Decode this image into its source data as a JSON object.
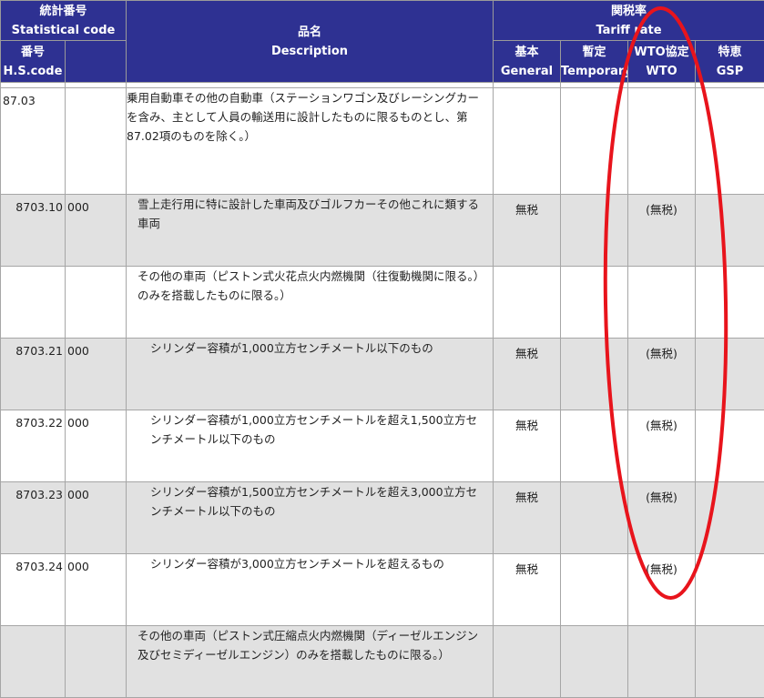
{
  "header": {
    "stat_code_jp": "統計番号",
    "stat_code_en": "Statistical code",
    "hs_jp": "番号",
    "hs_en": "H.S.code",
    "desc_jp": "品名",
    "desc_en": "Description",
    "tariff_jp": "関税率",
    "tariff_en": "Tariff rate",
    "general_jp": "基本",
    "general_en": "General",
    "temporary_jp": "暫定",
    "temporary_en": "Temporary",
    "wto_jp": "WTO協定",
    "wto_en": "WTO",
    "gsp_jp": "特恵",
    "gsp_en": "GSP"
  },
  "rows": [
    {
      "hs": "87.03",
      "stat": "",
      "desc": "乗用自動車その他の自動車（ステーションワゴン及びレーシングカーを含み、主として人員の輸送用に設計したものに限るものとし、第87.02項のものを除く。）",
      "general": "",
      "temporary": "",
      "wto": "",
      "gsp": ""
    },
    {
      "hs": "8703.10",
      "stat": "000",
      "desc": "雪上走行用に特に設計した車両及びゴルフカーその他これに類する車両",
      "general": "無税",
      "temporary": "",
      "wto": "(無税)",
      "gsp": ""
    },
    {
      "hs": "",
      "stat": "",
      "desc": "その他の車両（ピストン式火花点火内燃機関（往復動機関に限る。）のみを搭載したものに限る。）",
      "general": "",
      "temporary": "",
      "wto": "",
      "gsp": ""
    },
    {
      "hs": "8703.21",
      "stat": "000",
      "desc": "シリンダー容積が1,000立方センチメートル以下のもの",
      "general": "無税",
      "temporary": "",
      "wto": "(無税)",
      "gsp": ""
    },
    {
      "hs": "8703.22",
      "stat": "000",
      "desc": "シリンダー容積が1,000立方センチメートルを超え1,500立方センチメートル以下のもの",
      "general": "無税",
      "temporary": "",
      "wto": "(無税)",
      "gsp": ""
    },
    {
      "hs": "8703.23",
      "stat": "000",
      "desc": "シリンダー容積が1,500立方センチメートルを超え3,000立方センチメートル以下のもの",
      "general": "無税",
      "temporary": "",
      "wto": "(無税)",
      "gsp": ""
    },
    {
      "hs": "8703.24",
      "stat": "000",
      "desc": "シリンダー容積が3,000立方センチメートルを超えるもの",
      "general": "無税",
      "temporary": "",
      "wto": "(無税)",
      "gsp": ""
    },
    {
      "hs": "",
      "stat": "",
      "desc": "その他の車両（ピストン式圧縮点火内燃機関（ディーゼルエンジン及びセミディーゼルエンジン）のみを搭載したものに限る。）",
      "general": "",
      "temporary": "",
      "wto": "",
      "gsp": ""
    }
  ],
  "colors": {
    "header_bg": "#2e3192",
    "shaded_row": "#e1e1e1",
    "annotation": "#e8141c"
  }
}
